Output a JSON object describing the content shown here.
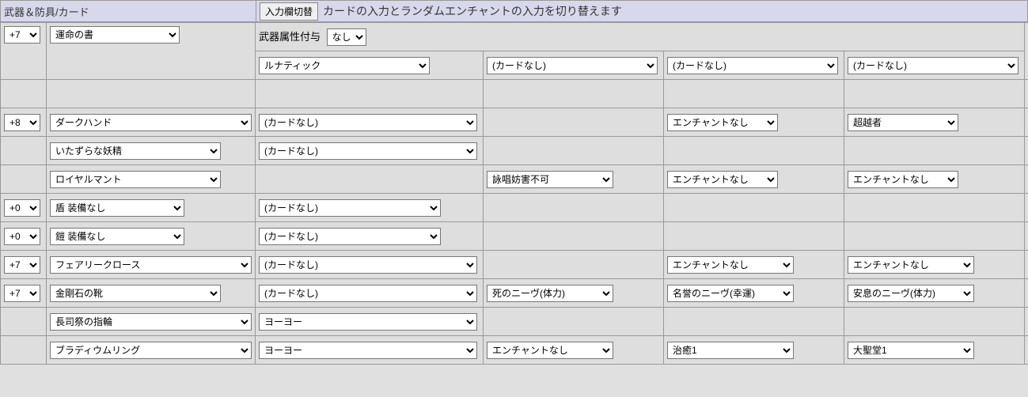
{
  "header": {
    "title": "武器＆防具/カード",
    "toggle_btn": "入力欄切替",
    "description": "カードの入力とランダムエンチャントの入力を切り替えます"
  },
  "attr": {
    "label": "武器属性付与",
    "value": "なし"
  },
  "rows": {
    "r1": {
      "refine": "+7",
      "item": "運命の書",
      "card1": "ルナティック",
      "card2": "(カードなし)",
      "card3": "(カードなし)",
      "card4": "(カードなし)"
    },
    "r2": {
      "refine": "+8",
      "item": "ダークハンド",
      "card1": "(カードなし)",
      "enc1": "エンチャントなし",
      "enc2": "超越者"
    },
    "r3": {
      "item": "いたずらな妖精",
      "card1": "(カードなし)"
    },
    "r4": {
      "item": "ロイヤルマント",
      "slot3": "詠唱妨害不可",
      "enc1": "エンチャントなし",
      "enc2": "エンチャントなし"
    },
    "r5": {
      "refine": "+0",
      "item": "盾 装備なし",
      "card1": "(カードなし)"
    },
    "r6": {
      "refine": "+0",
      "item": "鎧 装備なし",
      "card1": "(カードなし)"
    },
    "r7": {
      "refine": "+7",
      "item": "フェアリークロース",
      "card1": "(カードなし)",
      "enc1": "エンチャントなし",
      "enc2": "エンチャントなし"
    },
    "r8": {
      "refine": "+7",
      "item": "金剛石の靴",
      "card1": "(カードなし)",
      "slot3": "死のニーヴ(体力)",
      "slot4": "名誉のニーヴ(幸運)",
      "slot5": "安息のニーヴ(体力)"
    },
    "r9": {
      "item": "長司祭の指輪",
      "card1": "ヨーヨー"
    },
    "r10": {
      "item": "ブラディウムリング",
      "card1": "ヨーヨー",
      "slot3": "エンチャントなし",
      "slot4": "治癒1",
      "slot5": "大聖堂1"
    }
  }
}
